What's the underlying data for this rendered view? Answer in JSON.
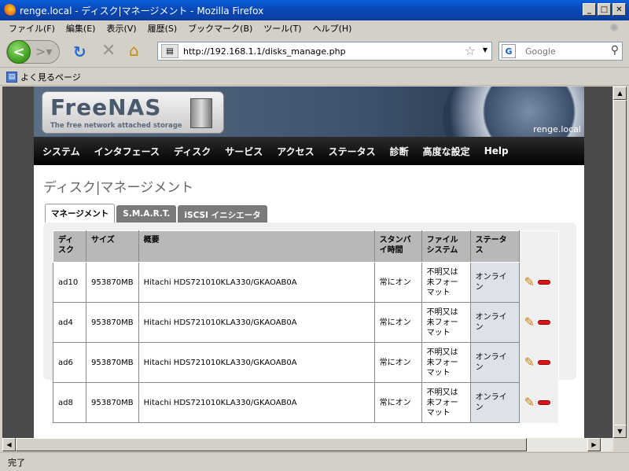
{
  "window": {
    "title": "renge.local - ディスク|マネージメント - Mozilla Firefox",
    "min": "_",
    "max": "□",
    "close": "✕"
  },
  "menu": [
    "ファイル(F)",
    "編集(E)",
    "表示(V)",
    "履歴(S)",
    "ブックマーク(B)",
    "ツール(T)",
    "ヘルプ(H)"
  ],
  "nav": {
    "url": "http://192.168.1.1/disks_manage.php",
    "search_placeholder": "Google"
  },
  "bookmarks": {
    "item": "よく見るページ"
  },
  "page": {
    "logo_title": "FreeNAS",
    "logo_sub": "The free network attached storage",
    "hostname": "renge.local",
    "topnav": [
      "システム",
      "インタフェース",
      "ディスク",
      "サービス",
      "アクセス",
      "ステータス",
      "診断",
      "高度な設定",
      "Help"
    ],
    "title": "ディスク|マネージメント",
    "tabs": [
      "マネージメント",
      "S.M.A.R.T.",
      "iSCSI イニシエータ"
    ],
    "table": {
      "headers": [
        "ディスク",
        "サイズ",
        "概要",
        "スタンバイ時間",
        "ファイルシステム",
        "ステータス"
      ],
      "rows": [
        {
          "disk": "ad10",
          "size": "953870MB",
          "desc": "Hitachi HDS721010KLA330/GKAOAB0A",
          "standby": "常にオン",
          "fs": "不明又は未フォーマット",
          "status": "オンライン"
        },
        {
          "disk": "ad4",
          "size": "953870MB",
          "desc": "Hitachi HDS721010KLA330/GKAOAB0A",
          "standby": "常にオン",
          "fs": "不明又は未フォーマット",
          "status": "オンライン"
        },
        {
          "disk": "ad6",
          "size": "953870MB",
          "desc": "Hitachi HDS721010KLA330/GKAOAB0A",
          "standby": "常にオン",
          "fs": "不明又は未フォーマット",
          "status": "オンライン"
        },
        {
          "disk": "ad8",
          "size": "953870MB",
          "desc": "Hitachi HDS721010KLA330/GKAOAB0A",
          "standby": "常にオン",
          "fs": "不明又は未フォーマット",
          "status": "オンライン"
        }
      ]
    }
  },
  "statusbar": {
    "text": "完了"
  }
}
